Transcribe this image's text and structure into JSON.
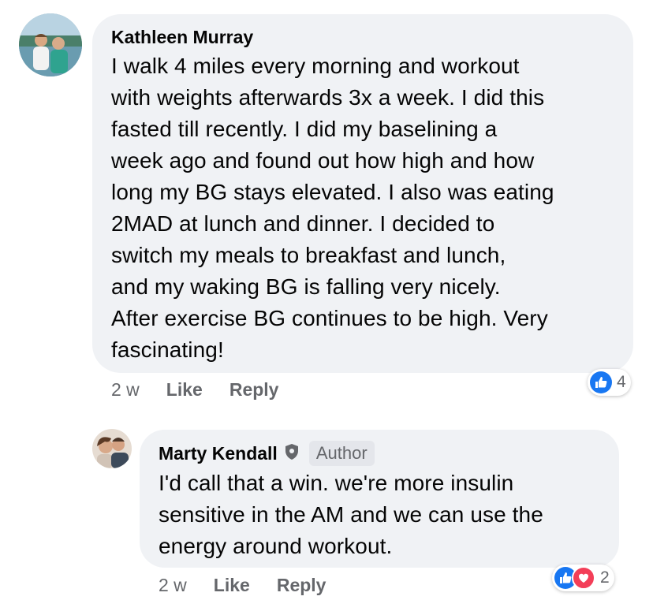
{
  "comments": [
    {
      "author": "Kathleen Murray",
      "text_lines": [
        "I walk 4 miles every morning and workout",
        "with weights afterwards 3x a week. I did this",
        "fasted till recently. I did my baselining a",
        "week ago and found out how high and how",
        "long my BG stays elevated. I also was eating",
        "2MAD at lunch and dinner. I decided to",
        "switch my meals to breakfast and lunch,",
        "and my waking BG is falling very nicely.",
        "After exercise BG continues to be high. Very",
        "fascinating!"
      ],
      "time": "2 w",
      "like_label": "Like",
      "reply_label": "Reply",
      "reaction_count": "4",
      "reaction_icons": [
        "like-icon"
      ]
    },
    {
      "author": "Marty Kendall",
      "badge": "Author",
      "text_lines": [
        "I'd call that a win.  we're more insulin",
        "sensitive in the AM and we can use the",
        "energy around workout."
      ],
      "time": "2 w",
      "like_label": "Like",
      "reply_label": "Reply",
      "reaction_count": "2",
      "reaction_icons": [
        "like-icon",
        "love-icon"
      ]
    }
  ],
  "colors": {
    "bubble": "#f0f2f5",
    "meta_text": "#65676b",
    "like_blue": "#1877f2",
    "love_red": "#f33e58"
  }
}
